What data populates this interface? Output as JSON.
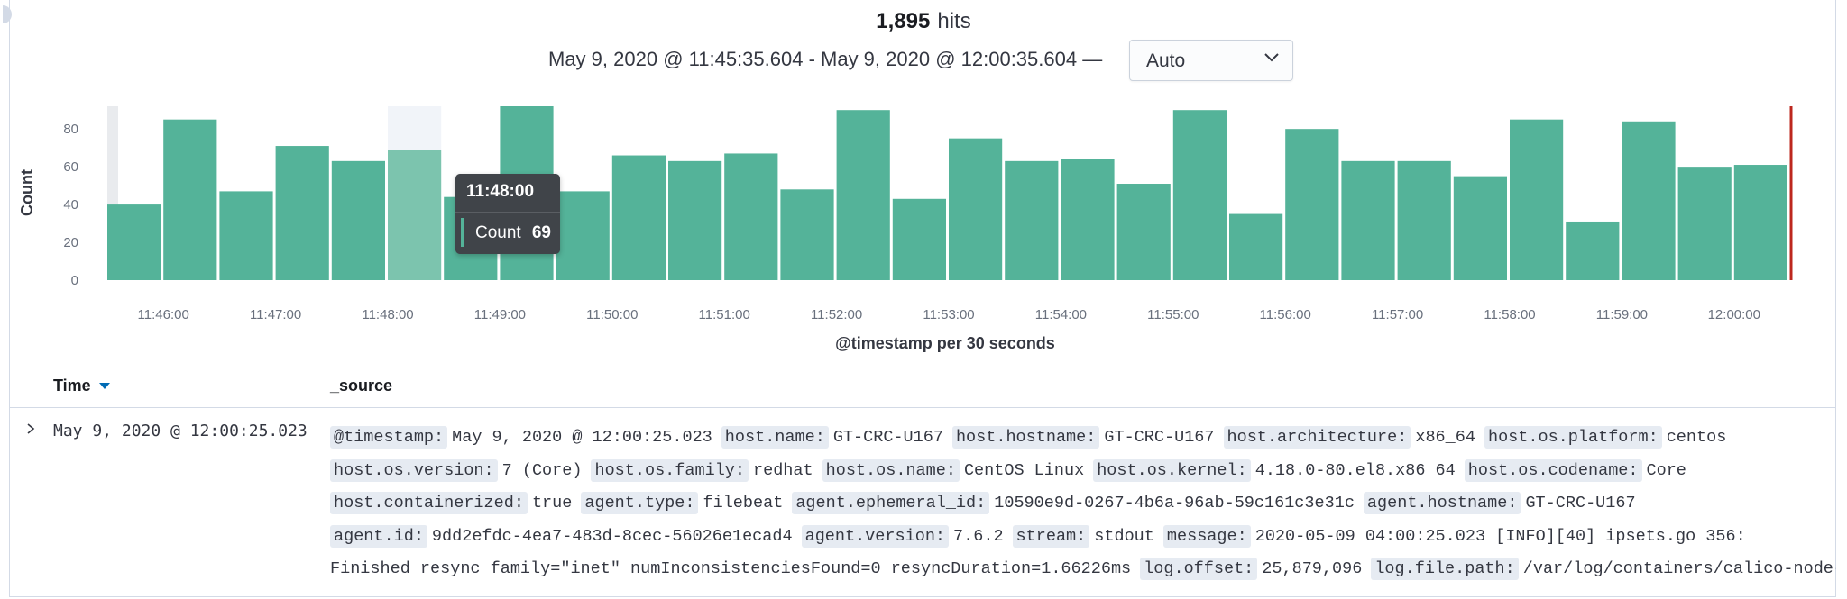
{
  "summary": {
    "hits_count": "1,895",
    "hits_label": "hits",
    "time_range": "May 9, 2020 @ 11:45:35.604 - May 9, 2020 @ 12:00:35.604 —",
    "interval_value": "Auto"
  },
  "chart_data": {
    "type": "bar",
    "x": [
      "11:45:30",
      "11:46:00",
      "11:46:30",
      "11:47:00",
      "11:47:30",
      "11:48:00",
      "11:48:30",
      "11:49:00",
      "11:49:30",
      "11:50:00",
      "11:50:30",
      "11:51:00",
      "11:51:30",
      "11:52:00",
      "11:52:30",
      "11:53:00",
      "11:53:30",
      "11:54:00",
      "11:54:30",
      "11:55:00",
      "11:55:30",
      "11:56:00",
      "11:56:30",
      "11:57:00",
      "11:57:30",
      "11:58:00",
      "11:58:30",
      "11:59:00",
      "11:59:30",
      "12:00:00"
    ],
    "values": [
      40,
      85,
      47,
      71,
      63,
      69,
      44,
      92,
      47,
      66,
      63,
      67,
      48,
      90,
      43,
      75,
      63,
      64,
      51,
      90,
      35,
      80,
      63,
      63,
      55,
      85,
      31,
      84,
      60,
      61
    ],
    "x_tick_labels": [
      "11:46:00",
      "11:47:00",
      "11:48:00",
      "11:49:00",
      "11:50:00",
      "11:51:00",
      "11:52:00",
      "11:53:00",
      "11:54:00",
      "11:55:00",
      "11:56:00",
      "11:57:00",
      "11:58:00",
      "11:59:00",
      "12:00:00"
    ],
    "y_ticks": [
      0,
      20,
      40,
      60,
      80
    ],
    "xlabel": "@timestamp per 30 seconds",
    "ylabel": "Count",
    "ylim": [
      0,
      92
    ],
    "highlighted_bucket": "11:48:00",
    "bar_color": "#54b399",
    "highlight_color": "#7cc4ae",
    "now_marker_color": "#bd271e"
  },
  "tooltip": {
    "title": "11:48:00",
    "key": "Count",
    "value": "69"
  },
  "table": {
    "col_time": "Time",
    "col_source": "_source",
    "row": {
      "time": "May 9, 2020 @ 12:00:25.023",
      "lines": [
        [
          {
            "k": "@timestamp:",
            "v": "May 9, 2020 @ 12:00:25.023"
          },
          {
            "k": "host.name:",
            "v": "GT-CRC-U167"
          },
          {
            "k": "host.hostname:",
            "v": "GT-CRC-U167"
          },
          {
            "k": "host.architecture:",
            "v": "x86_64"
          },
          {
            "k": "host.os.platform:",
            "v": "centos"
          }
        ],
        [
          {
            "k": "host.os.version:",
            "v": "7 (Core)"
          },
          {
            "k": "host.os.family:",
            "v": "redhat"
          },
          {
            "k": "host.os.name:",
            "v": "CentOS Linux"
          },
          {
            "k": "host.os.kernel:",
            "v": "4.18.0-80.el8.x86_64"
          },
          {
            "k": "host.os.codename:",
            "v": "Core"
          }
        ],
        [
          {
            "k": "host.containerized:",
            "v": "true"
          },
          {
            "k": "agent.type:",
            "v": "filebeat"
          },
          {
            "k": "agent.ephemeral_id:",
            "v": "10590e9d-0267-4b6a-96ab-59c161c3e31c"
          },
          {
            "k": "agent.hostname:",
            "v": "GT-CRC-U167"
          }
        ],
        [
          {
            "k": "agent.id:",
            "v": "9dd2efdc-4ea7-483d-8cec-56026e1ecad4"
          },
          {
            "k": "agent.version:",
            "v": "7.6.2"
          },
          {
            "k": "stream:",
            "v": "stdout"
          },
          {
            "k": "message:",
            "v": "2020-05-09 04:00:25.023 [INFO][40] ipsets.go 356:"
          }
        ],
        [
          {
            "k": "",
            "v": "Finished resync family=\"inet\" numInconsistenciesFound=0 resyncDuration=1.66226ms"
          },
          {
            "k": "log.offset:",
            "v": "25,879,096"
          },
          {
            "k": "log.file.path:",
            "v": "/var/log/containers/calico-node-"
          }
        ]
      ]
    }
  }
}
